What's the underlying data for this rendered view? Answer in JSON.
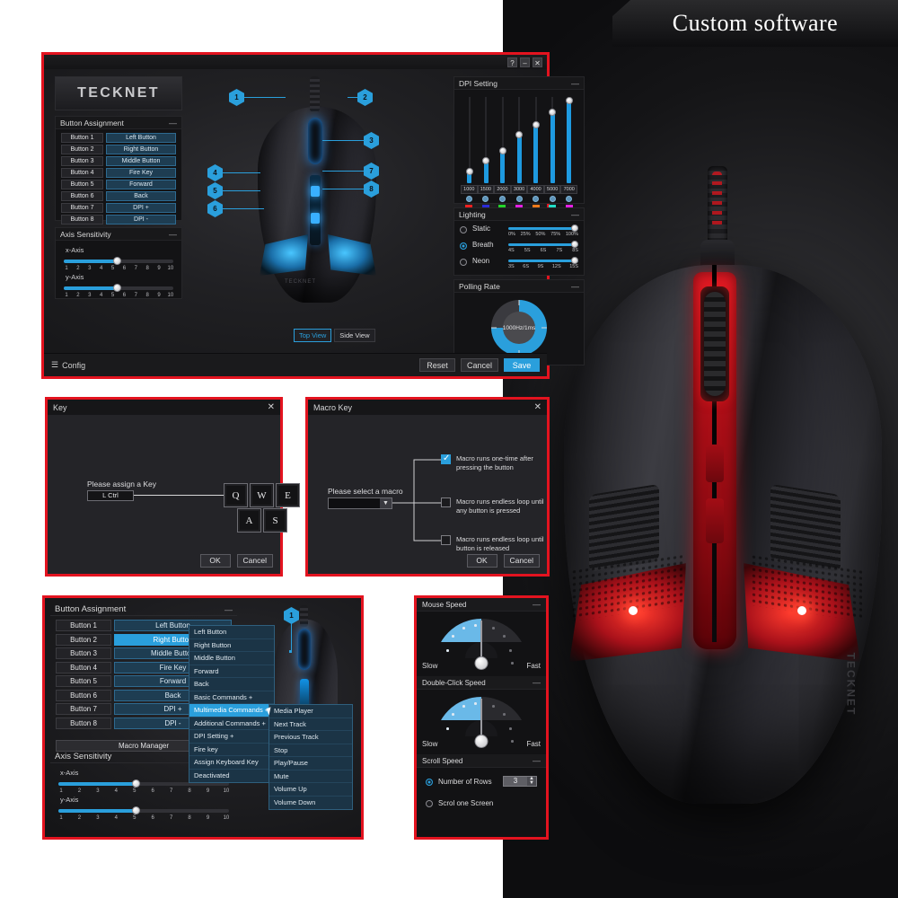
{
  "banner": {
    "text": "Custom software"
  },
  "brand": "TECKNET",
  "main_window": {
    "titlebar_buttons": [
      "?",
      "–",
      "✕"
    ],
    "button_assignment": {
      "title": "Button Assignment",
      "minimize": "—",
      "rows": [
        {
          "key": "Button 1",
          "value": "Left Button"
        },
        {
          "key": "Button 2",
          "value": "Right Button"
        },
        {
          "key": "Button 3",
          "value": "Middle Button"
        },
        {
          "key": "Button 4",
          "value": "Fire Key"
        },
        {
          "key": "Button 5",
          "value": "Forward"
        },
        {
          "key": "Button 6",
          "value": "Back"
        },
        {
          "key": "Button 7",
          "value": "DPI +"
        },
        {
          "key": "Button 8",
          "value": "DPI -"
        }
      ],
      "macro_manager": "Macro Manager"
    },
    "axis_sensitivity": {
      "title": "Axis Sensitivity",
      "minimize": "—",
      "x_label": "x-Axis",
      "y_label": "y-Axis",
      "ticks": [
        "1",
        "2",
        "3",
        "4",
        "5",
        "6",
        "7",
        "8",
        "9",
        "10"
      ],
      "x_value": 5,
      "y_value": 5,
      "max": 10
    },
    "diagram": {
      "callouts": [
        "1",
        "2",
        "3",
        "4",
        "5",
        "6",
        "7",
        "8"
      ],
      "device_label": "TECKNET",
      "tabs": [
        {
          "label": "Top View",
          "active": true
        },
        {
          "label": "Side View",
          "active": false
        }
      ]
    },
    "dpi_setting": {
      "title": "DPI Setting",
      "minimize": "—",
      "values": [
        "1000",
        "1500",
        "2000",
        "3000",
        "4000",
        "5000",
        "7000"
      ],
      "levels": [
        14,
        26,
        38,
        56,
        68,
        82,
        96
      ],
      "colors": [
        "#ee2020",
        "#2b2bd8",
        "#24d42a",
        "#e41fe4",
        "#ef7a1a",
        "#21dcc6",
        "#e41fe4"
      ]
    },
    "lighting": {
      "title": "Lighting",
      "minimize": "—",
      "modes": [
        {
          "name": "Static",
          "selected": false,
          "ticks": [
            "0%",
            "25%",
            "50%",
            "75%",
            "100%"
          ]
        },
        {
          "name": "Breath",
          "selected": true,
          "ticks": [
            "4S",
            "5S",
            "6S",
            "7S",
            "8S"
          ]
        },
        {
          "name": "Neon",
          "selected": false,
          "ticks": [
            "3S",
            "6S",
            "9S",
            "12S",
            "15S"
          ]
        }
      ]
    },
    "polling_rate": {
      "title": "Polling Rate",
      "minimize": "—",
      "value": "1000Hz/1ms"
    },
    "footer": {
      "config": "Config",
      "reset": "Reset",
      "cancel": "Cancel",
      "save": "Save"
    }
  },
  "key_dialog": {
    "title": "Key",
    "close": "✕",
    "prompt": "Please assign a Key",
    "assigned_key": "L Ctrl",
    "keycaps_row1": [
      "Q",
      "W",
      "E"
    ],
    "keycaps_row2": [
      "A",
      "S"
    ],
    "ok": "OK",
    "cancel": "Cancel"
  },
  "macro_dialog": {
    "title": "Macro Key",
    "close": "✕",
    "prompt": "Please select a macro",
    "select_value": "",
    "options": [
      {
        "text": "Macro runs one-time after pressing the button",
        "checked": true
      },
      {
        "text": "Macro runs endless loop until any button is pressed",
        "checked": false
      },
      {
        "text": "Macro runs endless loop until button is released",
        "checked": false
      }
    ],
    "ok": "OK",
    "cancel": "Cancel"
  },
  "ba_window": {
    "button_assignment": {
      "title": "Button Assignment",
      "minimize": "—",
      "rows": [
        {
          "key": "Button 1",
          "value": "Left Button",
          "selected": false
        },
        {
          "key": "Button 2",
          "value": "Right Button",
          "selected": true
        },
        {
          "key": "Button 3",
          "value": "Middle Button",
          "selected": false
        },
        {
          "key": "Button 4",
          "value": "Fire Key",
          "selected": false
        },
        {
          "key": "Button 5",
          "value": "Forward",
          "selected": false
        },
        {
          "key": "Button 6",
          "value": "Back",
          "selected": false
        },
        {
          "key": "Button 7",
          "value": "DPI +",
          "selected": false
        },
        {
          "key": "Button 8",
          "value": "DPI -",
          "selected": false
        }
      ],
      "macro_manager": "Macro Manager"
    },
    "axis_sensitivity": {
      "title": "Axis Sensitivity",
      "minimize": "—",
      "x_label": "x-Axis",
      "y_label": "y-Axis",
      "ticks": [
        "1",
        "2",
        "3",
        "4",
        "5",
        "6",
        "7",
        "8",
        "9",
        "10"
      ],
      "x_value": 5,
      "y_value": 5
    },
    "dropdown": {
      "items": [
        {
          "label": "Left Button",
          "selected": false
        },
        {
          "label": "Right Button",
          "selected": false
        },
        {
          "label": "Middle Button",
          "selected": false
        },
        {
          "label": "Forward",
          "selected": false
        },
        {
          "label": "Back",
          "selected": false
        },
        {
          "label": "Basic Commands +",
          "selected": false
        },
        {
          "label": "Multimedia Commands +",
          "selected": true
        },
        {
          "label": "Additional Commands +",
          "selected": false
        },
        {
          "label": "DPI Setting +",
          "selected": false
        },
        {
          "label": "Fire key",
          "selected": false
        },
        {
          "label": "Assign Keyboard Key",
          "selected": false
        },
        {
          "label": "Deactivated",
          "selected": false
        }
      ]
    },
    "submenu": {
      "items": [
        "Media Player",
        "Next Track",
        "Previous Track",
        "Stop",
        "Play/Pause",
        "Mute",
        "Volume Up",
        "Volume Down"
      ]
    },
    "callout": "1"
  },
  "speed_window": {
    "mouse_speed": {
      "title": "Mouse Speed",
      "minimize": "—",
      "slow": "Slow",
      "fast": "Fast",
      "angle_deg": 0
    },
    "double_click_speed": {
      "title": "Double-Click Speed",
      "minimize": "—",
      "slow": "Slow",
      "fast": "Fast",
      "angle_deg": 0
    },
    "scroll_speed": {
      "title": "Scroll Speed",
      "minimize": "—",
      "rows_label": "Number of Rows",
      "rows_value": "3",
      "rows_selected": true,
      "screen_label": "Scrol one Screen",
      "screen_selected": false
    }
  }
}
